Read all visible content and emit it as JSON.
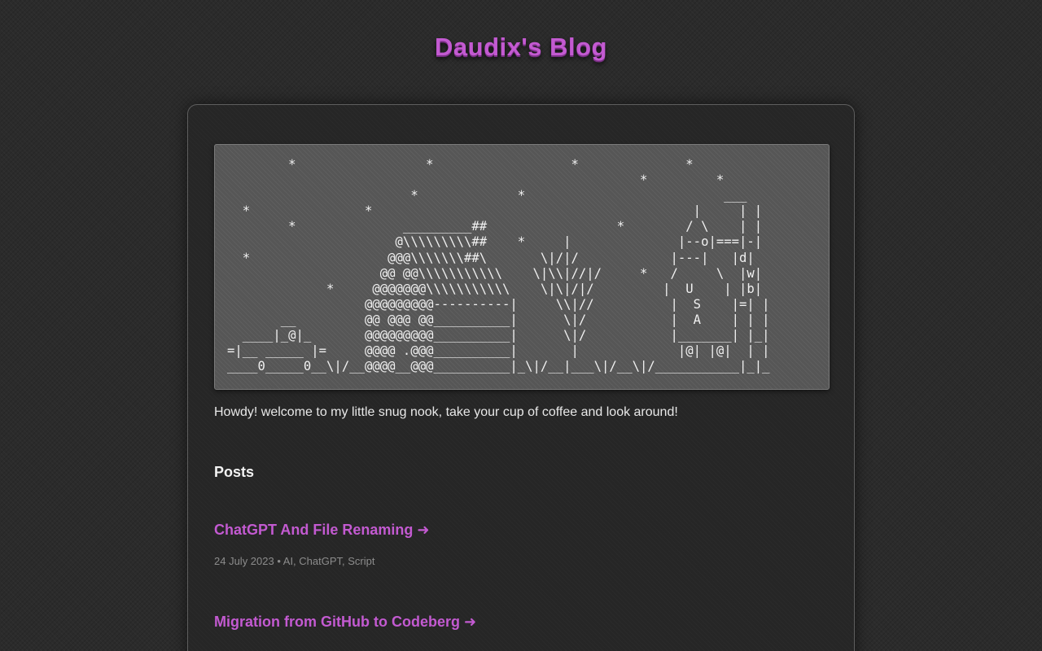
{
  "site": {
    "title": "Daudix's Blog"
  },
  "banner": {
    "ascii_art": "        *                 *                  *              *\n                                                      *         *\n                        *             *                          ___\n  *               *                                          |     | |\n        *              _________##                 *        / \\    | |\n                      @\\\\\\\\\\\\\\\\\\##    *     |              |--o|===|-|\n  *                  @@@\\\\\\\\\\\\\\##\\       \\|/|/            |---|   |d|\n                    @@ @@\\\\\\\\\\\\\\\\\\\\\\    \\|\\\\|//|/     *   /     \\  |w|\n             *     @@@@@@@\\\\\\\\\\\\\\\\\\\\\\    \\|\\|/|/         |  U    | |b|\n                  @@@@@@@@@----------|     \\\\|//          |  S    |=| |\n       __         @@ @@@ @@__________|      \\|/           |  A    | | |\n  ____|_@|_       @@@@@@@@@__________|      \\|/           |_______| |_|\n=|__ _____ |=     @@@@ .@@@__________|       |             |@| |@|  | |\n____0_____0__\\|/__@@@@__@@@__________|_\\|/__|___\\|/__\\|/___________|_|_"
  },
  "intro": {
    "text": "Howdy! welcome to my little snug nook, take your cup of coffee and look around!"
  },
  "posts": {
    "heading": "Posts",
    "items": [
      {
        "title": "ChatGPT And File Renaming ➜",
        "meta": "24 July 2023 • AI, ChatGPT, Script"
      },
      {
        "title": "Migration from GitHub to Codeberg ➜",
        "meta": ""
      }
    ]
  },
  "colors": {
    "accent": "#c35ad1",
    "background": "#2b2b2b",
    "panel": "#262626",
    "ascii_box": "#565656",
    "meta_text": "#8c8c8c"
  }
}
